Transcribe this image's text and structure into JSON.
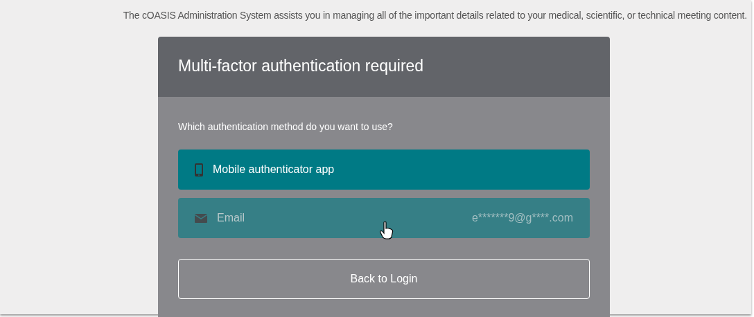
{
  "intro": "The cOASIS Administration System assists you in managing all of the important details related to your medical, scientific, or technical meeting content.",
  "card": {
    "title": "Multi-factor authentication required",
    "question": "Which authentication method do you want to use?"
  },
  "methods": [
    {
      "kind": "mobile",
      "label": "Mobile authenticator app",
      "disabled": false
    },
    {
      "kind": "email",
      "label": "Email",
      "detail": "e*******9@g****.com",
      "disabled": true
    }
  ],
  "back_button": "Back to Login"
}
